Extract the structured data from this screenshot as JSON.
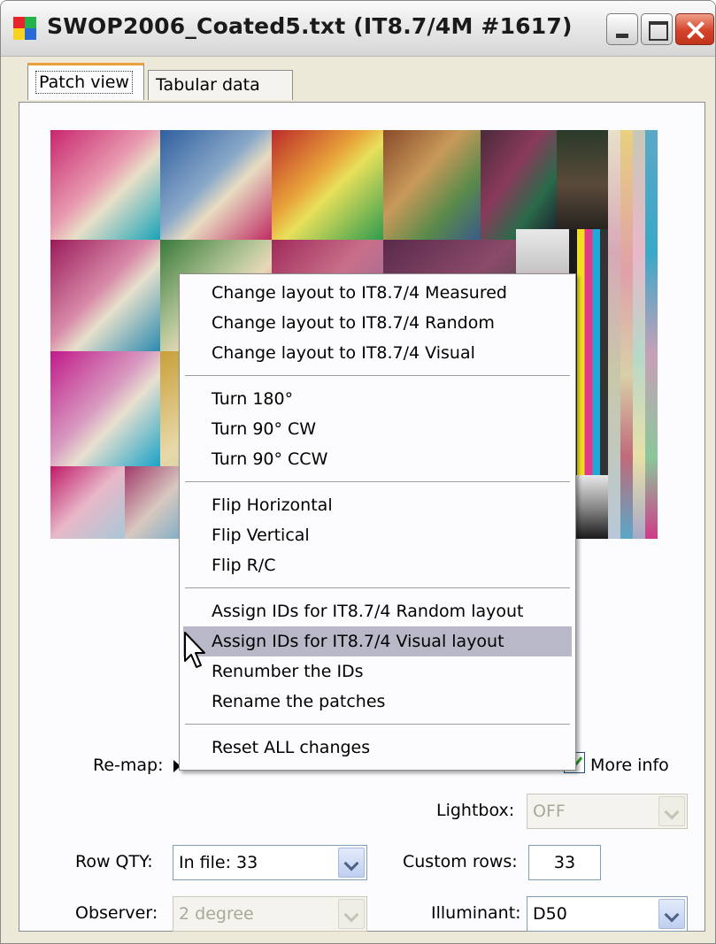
{
  "window": {
    "title": "SWOP2006_Coated5.txt (IT8.7/4M #1617)",
    "icon": "color-grid-icon"
  },
  "tabs": [
    {
      "label": "Patch view",
      "active": true
    },
    {
      "label": "Tabular data",
      "active": false
    }
  ],
  "context_menu": {
    "items": [
      {
        "label": "Change layout to IT8.7/4 Measured"
      },
      {
        "label": "Change layout to IT8.7/4 Random"
      },
      {
        "label": "Change layout to IT8.7/4 Visual"
      },
      {
        "label": "Turn 180°"
      },
      {
        "label": "Turn 90° CW"
      },
      {
        "label": "Turn 90° CCW"
      },
      {
        "label": "Flip Horizontal"
      },
      {
        "label": "Flip Vertical"
      },
      {
        "label": "Flip R/C"
      },
      {
        "label": "Assign IDs for IT8.7/4 Random layout"
      },
      {
        "label": "Assign IDs for IT8.7/4 Visual layout",
        "highlighted": true
      },
      {
        "label": "Renumber the IDs"
      },
      {
        "label": "Rename the patches"
      },
      {
        "label": "Reset ALL changes"
      }
    ]
  },
  "form": {
    "remap_label": "Re-map:",
    "more_info_label": "More info",
    "more_info_checked": true,
    "lightbox_label": "Lightbox:",
    "lightbox_value": "OFF",
    "row_qty_label": "Row QTY:",
    "row_qty_value": "In file: 33",
    "custom_rows_label": "Custom rows:",
    "custom_rows_value": "33",
    "observer_label": "Observer:",
    "observer_value": "2 degree",
    "illuminant_label": "Illuminant:",
    "illuminant_value": "D50"
  },
  "colors": {
    "menu_highlight": "#b8b8c8",
    "tab_accent": "#e9a23b",
    "close_button": "#d4432a"
  }
}
